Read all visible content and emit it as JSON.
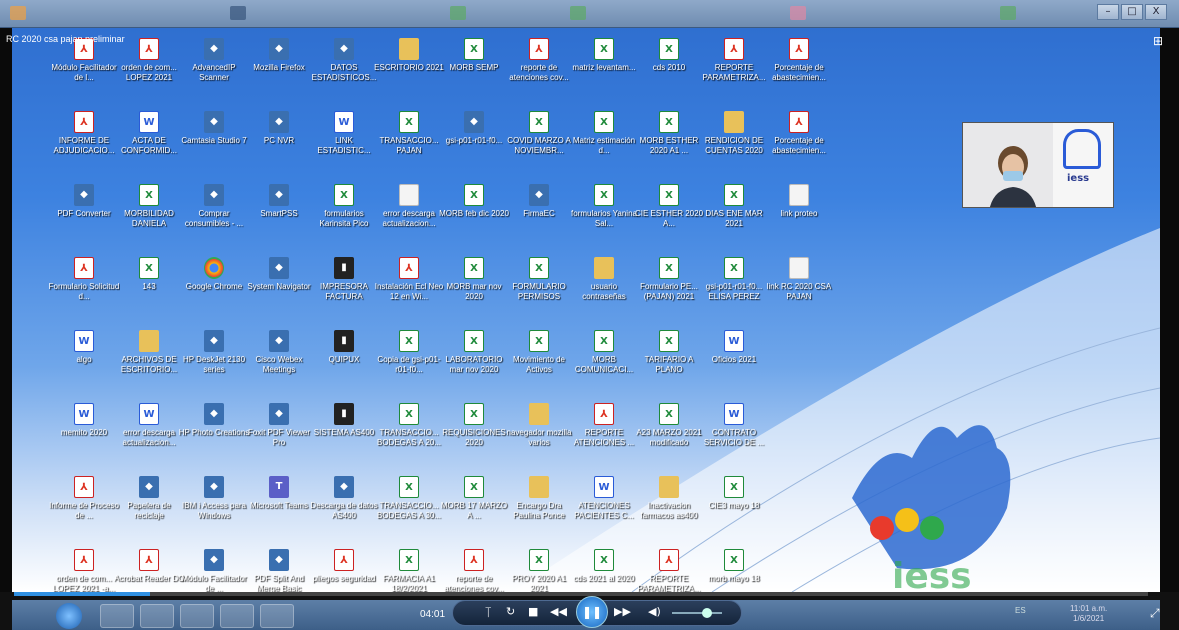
{
  "meeting": {
    "title": "RC 2020 csa pajan preliminar",
    "layout_icon": "grid-layout-icon"
  },
  "window_controls": {
    "minimize": "–",
    "maximize": "□",
    "close": "X"
  },
  "desktop_icons": [
    {
      "label": "Módulo Facilitador de l...",
      "type": "pdf"
    },
    {
      "label": "orden de com... LOPEZ 2021",
      "type": "pdf"
    },
    {
      "label": "AdvancedIP Scanner",
      "type": "app"
    },
    {
      "label": "Mozilla Firefox",
      "type": "app"
    },
    {
      "label": "DATOS ESTADISTICOS...",
      "type": "app"
    },
    {
      "label": "ESCRITORIO 2021",
      "type": "folder"
    },
    {
      "label": "MORB SEMP",
      "type": "excel"
    },
    {
      "label": "reporte de atenciones cov...",
      "type": "pdf"
    },
    {
      "label": "matriz levantam...",
      "type": "excel"
    },
    {
      "label": "cds 2010",
      "type": "excel"
    },
    {
      "label": "REPORTE PARAMETRIZA...",
      "type": "pdf"
    },
    {
      "label": "Porcentaje de abastecimien...",
      "type": "pdf"
    },
    {
      "label": "INFORME DE ADJUDICACIO...",
      "type": "pdf"
    },
    {
      "label": "ACTA DE CONFORMID...",
      "type": "word"
    },
    {
      "label": "Camtasia Studio 7",
      "type": "app"
    },
    {
      "label": "PC NVR",
      "type": "app"
    },
    {
      "label": "LINK ESTADISTIC...",
      "type": "word"
    },
    {
      "label": "TRANSACCIO... PAJAN",
      "type": "excel"
    },
    {
      "label": "gsi-p01-r01-f0...",
      "type": "app"
    },
    {
      "label": "COVID MARZO A NOVIEMBR...",
      "type": "excel"
    },
    {
      "label": "Matriz estimación d...",
      "type": "excel"
    },
    {
      "label": "MORB ESTHER 2020 A1 ...",
      "type": "excel"
    },
    {
      "label": "RENDICION DE CUENTAS 2020",
      "type": "folder"
    },
    {
      "label": "Porcentaje de abastecimien...",
      "type": "pdf"
    },
    {
      "label": "PDF Converter",
      "type": "app"
    },
    {
      "label": "MORBILIDAD DANIELA",
      "type": "excel"
    },
    {
      "label": "Comprar consumibles - ...",
      "type": "app"
    },
    {
      "label": "SmartPSS",
      "type": "app"
    },
    {
      "label": "formularios Karinsita Pico",
      "type": "excel"
    },
    {
      "label": "error descarga actualizacion...",
      "type": "doc"
    },
    {
      "label": "MORB feb dic 2020",
      "type": "excel"
    },
    {
      "label": "FirmaEC",
      "type": "app"
    },
    {
      "label": "formularios Yanina Sal...",
      "type": "excel"
    },
    {
      "label": "CIE ESTHER 2020 A...",
      "type": "excel"
    },
    {
      "label": "DIAS ENE MAR 2021",
      "type": "excel"
    },
    {
      "label": "link proteo",
      "type": "doc"
    },
    {
      "label": "Formulario Solicitud d...",
      "type": "pdf"
    },
    {
      "label": "143",
      "type": "excel"
    },
    {
      "label": "Google Chrome",
      "type": "chrome"
    },
    {
      "label": "System Navigator",
      "type": "app"
    },
    {
      "label": "IMPRESORA FACTURA",
      "type": "dark"
    },
    {
      "label": "Instalación Ecl Neo 12 en Wi...",
      "type": "pdf"
    },
    {
      "label": "MORB mar nov 2020",
      "type": "excel"
    },
    {
      "label": "FORMULARIO PERMISOS",
      "type": "excel"
    },
    {
      "label": "usuario contraseñas",
      "type": "folder"
    },
    {
      "label": "Formulario PE... (PAJAN) 2021",
      "type": "excel"
    },
    {
      "label": "gsi-p01-r01-f0... ELISA PEREZ",
      "type": "excel"
    },
    {
      "label": "link RC 2020 CSA PAJAN",
      "type": "doc"
    },
    {
      "label": "algo",
      "type": "word"
    },
    {
      "label": "ARCHIVOS DE ESCRITORIO...",
      "type": "folder"
    },
    {
      "label": "HP DeskJet 2130 series",
      "type": "app"
    },
    {
      "label": "Cisco Webex Meetings",
      "type": "app"
    },
    {
      "label": "QUIPUX",
      "type": "dark"
    },
    {
      "label": "Copia de gsi-p01-r01-f0...",
      "type": "excel"
    },
    {
      "label": "LABORATORIO mar nov 2020",
      "type": "excel"
    },
    {
      "label": "Movimiento de Activos",
      "type": "excel"
    },
    {
      "label": "MORB COMUNICACI...",
      "type": "excel"
    },
    {
      "label": "TARIFARIO A PLANO",
      "type": "excel"
    },
    {
      "label": "Oficios 2021",
      "type": "word"
    },
    {
      "label": "memito 2020",
      "type": "word"
    },
    {
      "label": "error descarga actualizacion...",
      "type": "word"
    },
    {
      "label": "HP Photo Creations",
      "type": "app"
    },
    {
      "label": "Foxit PDF Viewer Pro",
      "type": "app"
    },
    {
      "label": "SISTEMA AS400",
      "type": "dark"
    },
    {
      "label": "TRANSACCIO... BODEGAS A 20...",
      "type": "excel"
    },
    {
      "label": "REQUISICIONES 2020",
      "type": "excel"
    },
    {
      "label": "navegador mozilla varios",
      "type": "folder"
    },
    {
      "label": "REPORTE ATENCIONES ...",
      "type": "pdf"
    },
    {
      "label": "A23 MARZO 2021 modificado",
      "type": "excel"
    },
    {
      "label": "CONTRATO SERVICIO DE ...",
      "type": "word"
    },
    {
      "label": "Informe de Proceso de ...",
      "type": "pdf"
    },
    {
      "label": "Papelera de reciclaje",
      "type": "app"
    },
    {
      "label": "IBM i Access para Windows",
      "type": "app"
    },
    {
      "label": "Microsoft Teams",
      "type": "teams"
    },
    {
      "label": "Descarga de datos AS400",
      "type": "app"
    },
    {
      "label": "TRANSACCIO... BODEGAS A 30...",
      "type": "excel"
    },
    {
      "label": "MORB 17 MARZO A ...",
      "type": "excel"
    },
    {
      "label": "Encargo Dra Paulina Ponce",
      "type": "folder"
    },
    {
      "label": "ATENCIONES PACIENTES C...",
      "type": "word"
    },
    {
      "label": "Inactivacion farmacos as400",
      "type": "folder"
    },
    {
      "label": "CIE3 mayo 18",
      "type": "excel"
    },
    {
      "label": "orden de com... LOPEZ 2021 -a...",
      "type": "pdf"
    },
    {
      "label": "Acrobat Reader DC",
      "type": "pdf"
    },
    {
      "label": "Módulo Facilitador de ...",
      "type": "app"
    },
    {
      "label": "PDF Split And Merge Basic",
      "type": "app"
    },
    {
      "label": "pliegos seguridad",
      "type": "pdf"
    },
    {
      "label": "FARMACIA A1 18/2/2021",
      "type": "excel"
    },
    {
      "label": "reporte de atenciones cov...",
      "type": "pdf"
    },
    {
      "label": "PROY 2020 A1 2021",
      "type": "excel"
    },
    {
      "label": "cds 2021 al 2020",
      "type": "excel"
    },
    {
      "label": "REPORTE PARAMETRIZA...",
      "type": "pdf"
    },
    {
      "label": "morb mayo 18",
      "type": "excel"
    }
  ],
  "participant_video": {
    "org_text": "iess"
  },
  "playback": {
    "elapsed": "04:01",
    "progress_fraction": 0.12,
    "volume_fraction": 0.7,
    "controls": {
      "captions": "꓄",
      "loop": "↻",
      "stop": "■",
      "rewind": "◀◀",
      "play": "❚❚",
      "forward": "▶▶",
      "volume": "◀)"
    }
  },
  "clock": {
    "time": "11:01 a.m.",
    "date": "1/6/2021"
  },
  "tray_text": "ES"
}
